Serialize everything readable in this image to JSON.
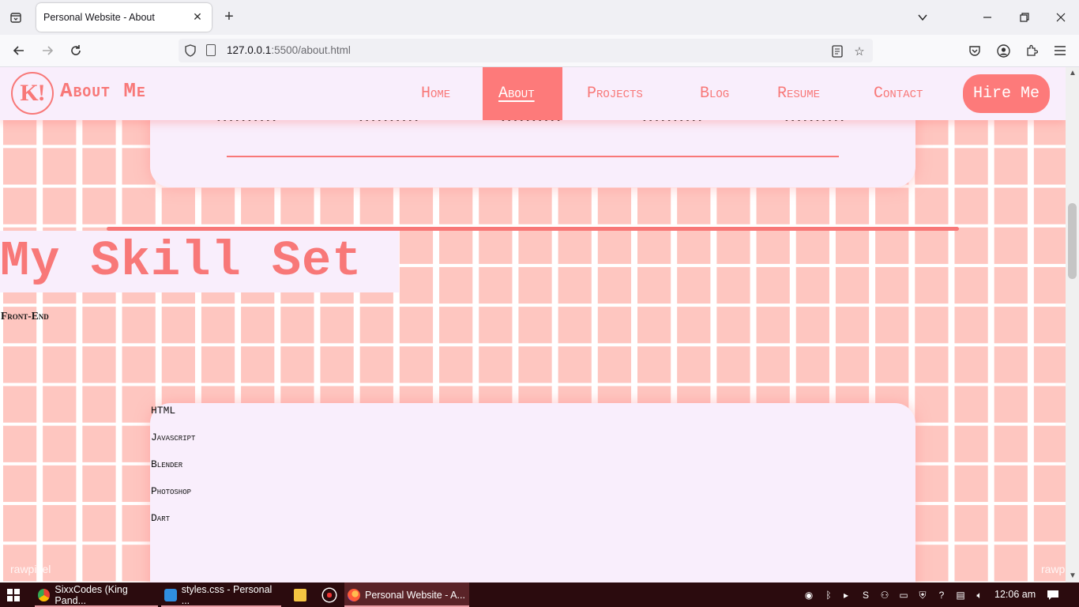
{
  "browser": {
    "tab_title": "Personal Website - About",
    "url_host": "127.0.0.1",
    "url_rest": ":5500/about.html"
  },
  "site": {
    "logo_text": "K!",
    "name": "About Me",
    "menu": [
      "Home",
      "About",
      "Projects",
      "Blog",
      "Resume",
      "Contact"
    ],
    "active_menu": "About",
    "hire_button": "Hire Me"
  },
  "content": {
    "skills_heading": "My Skill Set",
    "subheading": "Front-End",
    "skills": [
      "HTML",
      "Javascript",
      "Blender",
      "Photoshop",
      "Dart"
    ],
    "watermark": "rawpixel"
  },
  "taskbar": {
    "items": [
      "SixxCodes (King Pand...",
      "styles.css - Personal ...",
      "Personal Website - A..."
    ],
    "time": "12:06 am"
  },
  "colors": {
    "accent": "#f87878",
    "accent_fill": "#fd7a7a",
    "card_bg": "#f9eefc",
    "grid_tile": "#fec6c0",
    "taskbar": "#2b0b0e"
  }
}
